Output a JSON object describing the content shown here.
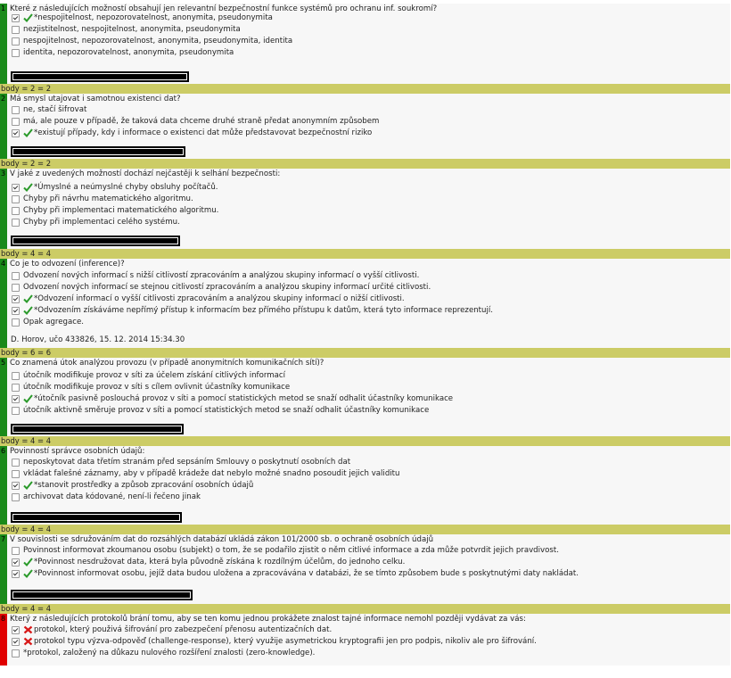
{
  "questions": [
    {
      "num": "1",
      "text": "Které z následujících možností obsahují jen relevantní bezpečnostní funkce systémů pro ochranu inf. soukromí?",
      "options": [
        {
          "label": "*nespojitelnost, nepozorovatelnost, anonymita, pseudonymita",
          "checked": true,
          "mark": "check"
        },
        {
          "label": "nezjistitelnost, nespojitelnost, anonymita, pseudonymita",
          "checked": false,
          "mark": ""
        },
        {
          "label": "nespojitelnost, nepozorovatelnost, anonymita, pseudonymita, identita",
          "checked": false,
          "mark": ""
        },
        {
          "label": "identita, nepozorovatelnost, anonymita, pseudonymita",
          "checked": false,
          "mark": ""
        }
      ],
      "author": "",
      "score": "body = 2 = 2",
      "bar": "green"
    },
    {
      "num": "2",
      "text": "Má smysl utajovat i samotnou existenci dat?",
      "options": [
        {
          "label": "ne, stačí šifrovat",
          "checked": false,
          "mark": ""
        },
        {
          "label": "má, ale pouze v případě, že taková data chceme druhé straně předat anonymním způsobem",
          "checked": false,
          "mark": ""
        },
        {
          "label": "*existují případy, kdy i informace o existenci dat může představovat bezpečnostní riziko",
          "checked": true,
          "mark": "check"
        }
      ],
      "author": "",
      "score": "body = 2 = 2",
      "bar": "green"
    },
    {
      "num": "3",
      "text": "V jaké z uvedených možností dochází nejčastěji k selhání bezpečnosti:",
      "options": [
        {
          "label": "*Úmyslné a neúmyslné chyby obsluhy počítačů.",
          "checked": true,
          "mark": "check"
        },
        {
          "label": "Chyby při návrhu matematického algoritmu.",
          "checked": false,
          "mark": ""
        },
        {
          "label": "Chyby při implementaci matematického algoritmu.",
          "checked": false,
          "mark": ""
        },
        {
          "label": "Chyby při implementaci celého systému.",
          "checked": false,
          "mark": ""
        }
      ],
      "author": "",
      "score": "body = 4 = 4",
      "bar": "green"
    },
    {
      "num": "4",
      "text": "Co je to odvození (inference)?",
      "options": [
        {
          "label": "Odvození nových informací s nižší citlivostí zpracováním a analýzou skupiny informací o vyšší citlivosti.",
          "checked": false,
          "mark": ""
        },
        {
          "label": "Odvození nových informací se stejnou citlivostí zpracováním a analýzou skupiny informací určité citlivosti.",
          "checked": false,
          "mark": ""
        },
        {
          "label": "*Odvození informací o vyšší citlivosti zpracováním a analýzou skupiny informací o nižší citlivosti.",
          "checked": true,
          "mark": "check"
        },
        {
          "label": "*Odvozením získáváme nepřímý přístup k informacím bez přímého přístupu k datům, která tyto informace reprezentují.",
          "checked": true,
          "mark": "check"
        },
        {
          "label": "Opak agregace.",
          "checked": false,
          "mark": ""
        }
      ],
      "author": "D. Horov, učo 433826, 15. 12. 2014 15:34.30",
      "score": "body = 6 = 6",
      "bar": "green"
    },
    {
      "num": "5",
      "text": "Co znamená útok analýzou provozu (v případě anonymitních komunikačních sítí)?",
      "options": [
        {
          "label": "útočník modifikuje provoz v síti za účelem získání citlivých informací",
          "checked": false,
          "mark": ""
        },
        {
          "label": "útočník modifikuje provoz v síti s cílem ovlivnit účastníky komunikace",
          "checked": false,
          "mark": ""
        },
        {
          "label": "*útočník pasivně poslouchá provoz v síti a pomocí statistických metod se snaží odhalit účastníky komunikace",
          "checked": true,
          "mark": "check"
        },
        {
          "label": "útočník aktivně směruje provoz v síti a pomocí statistických metod se snaží odhalit účastníky komunikace",
          "checked": false,
          "mark": ""
        }
      ],
      "author": "",
      "score": "body = 4 = 4",
      "bar": "green"
    },
    {
      "num": "6",
      "text": "Povinností správce osobních údajů:",
      "options": [
        {
          "label": "neposkytovat data třetím stranám před sepsáním Smlouvy o poskytnutí osobních dat",
          "checked": false,
          "mark": ""
        },
        {
          "label": "vkládat falešné záznamy, aby v případě krádeže dat nebylo možné snadno posoudit jejich validitu",
          "checked": false,
          "mark": ""
        },
        {
          "label": "*stanovit prostředky a způsob zpracování osobních údajů",
          "checked": true,
          "mark": "check"
        },
        {
          "label": "archivovat data kódované, není-li řečeno jinak",
          "checked": false,
          "mark": ""
        }
      ],
      "author": "",
      "score": "body = 4 = 4",
      "bar": "green"
    },
    {
      "num": "7",
      "text": "V souvislosti se sdružováním dat do rozsáhlých databází ukládá zákon 101/2000 sb. o ochraně osobních údajů",
      "options": [
        {
          "label": "Povinnost informovat zkoumanou osobu (subjekt) o tom, že se podařilo zjistit o něm citlivé informace a zda může potvrdit jejich pravdivost.",
          "checked": false,
          "mark": ""
        },
        {
          "label": "*Povinnost nesdružovat data, která byla původně získána k rozdílným účelům, do jednoho celku.",
          "checked": true,
          "mark": "check"
        },
        {
          "label": "*Povinnost informovat osobu, jejíž data budou uložena a zpracovávána v databázi, že se tímto způsobem bude s poskytnutými daty nakládat.",
          "checked": true,
          "mark": "check"
        }
      ],
      "author": "",
      "score": "body = 4 = 4",
      "bar": "green"
    },
    {
      "num": "8",
      "text": "Který z následujících protokolů brání tomu, aby se ten komu jednou prokážete znalost tajné informace nemohl později vydávat za vás:",
      "options": [
        {
          "label": "protokol, který použivá šifrování pro zabezpečení přenosu autentizačních dat.",
          "checked": true,
          "mark": "cross"
        },
        {
          "label": "protokol typu výzva-odpověď (challenge-response), který využije asymetrickou kryptografii jen pro podpis, nikoliv ale pro šifrování.",
          "checked": true,
          "mark": "cross"
        },
        {
          "label": "*protokol, založený na důkazu nulového rozšíření znalosti (zero-knowledge).",
          "checked": false,
          "mark": ""
        }
      ],
      "author": "",
      "score": "",
      "bar": "red"
    }
  ]
}
